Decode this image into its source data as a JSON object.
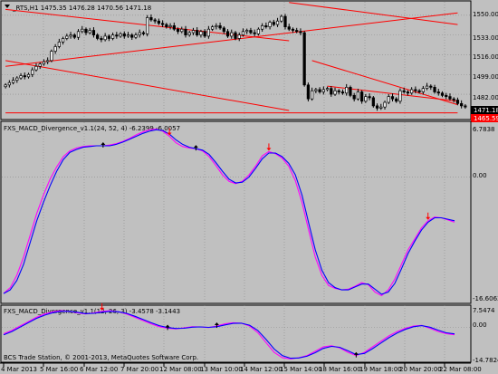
{
  "colors": {
    "background": "#c0c0c0",
    "grid": "#8c8c8c",
    "bull_candle": "#ffffff",
    "bear_candle": "#000000",
    "trendline": "#ff0000",
    "macd_line": "#0000ff",
    "signal_line": "#ff00ff",
    "price_tag_bg": "#000000",
    "price_tag_red": "#ff0000",
    "arrow_up": "#000000",
    "arrow_down": "#ff0000"
  },
  "main_panel": {
    "title": "_RTS,H1  1475.35 1476.28 1470.56 1471.18",
    "y_ticks": [
      "1550.00",
      "1533.00",
      "1516.00",
      "1499.00",
      "1482.00"
    ],
    "current_price": "1471.18",
    "red_price": "1465.59"
  },
  "indicator1": {
    "title": "FXS_MACD_Divergence_v1.1(24, 52, 4) -6.2399 -6.0057",
    "y_ticks": [
      "6.7838",
      "0.00",
      "-16.6063"
    ]
  },
  "indicator2": {
    "title": "FXS_MACD_Divergence_v1.1(12, 26, 3) -3.4578 -3.1443",
    "y_ticks": [
      "7.5474",
      "0.00",
      "-14.7824"
    ]
  },
  "copyright": "BCS Trade Station, © 2001-2013, MetaQuotes Software Corp.",
  "x_ticks": [
    "4 Mar 2013",
    "5 Mar 16:00",
    "6 Mar 12:00",
    "7 Mar 20:00",
    "12 Mar 08:00",
    "13 Mar 10:00",
    "14 Mar 12:00",
    "15 Mar 14:00",
    "18 Mar 16:00",
    "19 Mar 18:00",
    "20 Mar 20:00",
    "22 Mar 08:00"
  ],
  "chart_data": [
    {
      "type": "candlestick",
      "title": "_RTS,H1  1475.35 1476.28 1470.56 1471.18",
      "symbol": "_RTS,H1",
      "ohlc_last": {
        "open": 1475.35,
        "high": 1476.28,
        "low": 1470.56,
        "close": 1471.18
      },
      "ylim": [
        1461,
        1560
      ],
      "x_labels": [
        "4 Mar 2013",
        "5 Mar 16:00",
        "6 Mar 12:00",
        "7 Mar 20:00",
        "12 Mar 08:00",
        "13 Mar 10:00",
        "14 Mar 12:00",
        "15 Mar 14:00",
        "18 Mar 16:00",
        "19 Mar 18:00",
        "20 Mar 20:00",
        "22 Mar 08:00"
      ],
      "close_series": [
        1490,
        1492,
        1494,
        1496,
        1498,
        1497,
        1499,
        1503,
        1506,
        1508,
        1510,
        1511,
        1519,
        1523,
        1527,
        1530,
        1532,
        1533,
        1531,
        1536,
        1538,
        1535,
        1537,
        1533,
        1530,
        1529,
        1532,
        1530,
        1533,
        1532,
        1534,
        1532,
        1533,
        1531,
        1533,
        1535,
        1534,
        1548,
        1546,
        1545,
        1543,
        1542,
        1540,
        1541,
        1538,
        1536,
        1538,
        1533,
        1535,
        1537,
        1533,
        1536,
        1532,
        1538,
        1540,
        1541,
        1539,
        1536,
        1532,
        1535,
        1530,
        1533,
        1536,
        1537,
        1535,
        1534,
        1538,
        1541,
        1540,
        1544,
        1542,
        1545,
        1549,
        1540,
        1538,
        1537,
        1536,
        1535,
        1490,
        1478,
        1485,
        1486,
        1484,
        1486,
        1487,
        1482,
        1485,
        1484,
        1483,
        1488,
        1481,
        1478,
        1484,
        1476,
        1480,
        1479,
        1472,
        1470,
        1471,
        1475,
        1480,
        1478,
        1476,
        1485,
        1484,
        1483,
        1486,
        1485,
        1484,
        1487,
        1489,
        1488,
        1484,
        1483,
        1481,
        1480,
        1478,
        1477,
        1474,
        1472,
        1471
      ],
      "trendlines": [
        {
          "from": [
            0,
            1555
          ],
          "to": [
            74,
            1528
          ]
        },
        {
          "from": [
            0,
            1506
          ],
          "to": [
            118,
            1552
          ]
        },
        {
          "from": [
            0,
            1511
          ],
          "to": [
            74,
            1468
          ]
        },
        {
          "from": [
            74,
            1561
          ],
          "to": [
            118,
            1542
          ]
        },
        {
          "from": [
            80,
            1511
          ],
          "to": [
            118,
            1473
          ]
        },
        {
          "from": [
            84,
            1489
          ],
          "to": [
            118,
            1476
          ]
        },
        {
          "from": [
            0,
            1466
          ],
          "to": [
            118,
            1466
          ]
        }
      ]
    },
    {
      "type": "line",
      "title": "FXS_MACD_Divergence_v1.1(24, 52, 4) -6.2399 -6.0057",
      "ylim": [
        -16.6063,
        6.7838
      ],
      "series": [
        {
          "values": [
            -16.0,
            -15.2,
            -13.5,
            -11.0,
            -8.0,
            -5.0,
            -2.5,
            -0.3,
            1.4,
            2.8,
            3.6,
            4.0,
            4.2,
            4.3,
            4.3,
            4.3,
            4.4,
            4.6,
            4.9,
            5.3,
            5.8,
            6.2,
            6.5,
            6.6,
            6.3,
            5.6,
            4.7,
            4.2,
            4.0,
            3.9,
            3.6,
            2.8,
            1.6,
            0.3,
            -0.6,
            -0.9,
            -0.6,
            0.3,
            1.5,
            2.9,
            3.5,
            3.2,
            2.6,
            1.5,
            -0.5,
            -3.5,
            -7.3,
            -11.0,
            -13.5,
            -14.9,
            -15.3,
            -15.5,
            -15.4,
            -15.0,
            -14.5,
            -14.8,
            -15.8,
            -16.3,
            -15.5,
            -14.0,
            -12.0,
            -10.0,
            -8.5,
            -7.0,
            -6.0,
            -5.5,
            -5.6,
            -5.9,
            -6.2
          ]
        },
        {
          "values": [
            -16.0,
            -15.5,
            -14.2,
            -12.0,
            -9.0,
            -6.0,
            -3.5,
            -1.2,
            0.8,
            2.4,
            3.4,
            3.8,
            4.1,
            4.2,
            4.3,
            4.3,
            4.3,
            4.5,
            4.8,
            5.2,
            5.6,
            6.0,
            6.3,
            6.5,
            6.4,
            5.9,
            5.1,
            4.5,
            4.1,
            3.9,
            3.7,
            3.1,
            2.0,
            0.8,
            -0.3,
            -0.8,
            -0.7,
            0.0,
            1.2,
            2.5,
            3.3,
            3.3,
            2.8,
            1.9,
            0.3,
            -2.5,
            -6.3,
            -10.0,
            -12.8,
            -14.5,
            -15.2,
            -15.5,
            -15.5,
            -15.1,
            -14.7,
            -14.7,
            -15.4,
            -16.1,
            -15.8,
            -14.6,
            -12.6,
            -10.5,
            -8.8,
            -7.3,
            -6.2,
            -5.6,
            -5.6,
            -5.8,
            -6.0
          ]
        }
      ],
      "markers": [
        {
          "index": 15,
          "value": 4.3,
          "kind": "up"
        },
        {
          "index": 25,
          "value": 5.6,
          "kind": "down"
        },
        {
          "index": 29,
          "value": 3.9,
          "kind": "up"
        },
        {
          "index": 40,
          "value": 3.5,
          "kind": "down"
        },
        {
          "index": 64,
          "value": -6.0,
          "kind": "down"
        }
      ]
    },
    {
      "type": "line",
      "title": "FXS_MACD_Divergence_v1.1(12, 26, 3) -3.4578 -3.1443",
      "ylim": [
        -14.7824,
        7.5474
      ],
      "series": [
        {
          "values": [
            -3.0,
            -1.5,
            0.5,
            2.5,
            4.5,
            6.0,
            7.0,
            7.5,
            7.2,
            6.5,
            6.0,
            6.5,
            7.2,
            7.5,
            7.0,
            6.0,
            4.5,
            3.0,
            1.5,
            0.2,
            -0.5,
            -0.8,
            -0.3,
            0.2,
            0.1,
            -0.2,
            0.5,
            1.5,
            2.0,
            1.8,
            0.5,
            -2.5,
            -7.0,
            -11.5,
            -14.0,
            -14.5,
            -14.0,
            -13.0,
            -11.0,
            -9.0,
            -8.5,
            -9.5,
            -11.5,
            -13.0,
            -11.5,
            -9.0,
            -6.5,
            -4.0,
            -2.0,
            -0.5,
            0.5,
            0.8,
            -0.5,
            -2.0,
            -3.0,
            -3.5
          ]
        },
        {
          "values": [
            -3.5,
            -2.0,
            0.0,
            2.0,
            4.0,
            5.5,
            6.6,
            7.2,
            7.2,
            6.8,
            6.2,
            6.3,
            6.8,
            7.2,
            7.0,
            6.3,
            5.0,
            3.5,
            2.0,
            0.7,
            -0.2,
            -0.6,
            -0.5,
            0.0,
            0.1,
            -0.1,
            0.2,
            1.0,
            1.7,
            1.8,
            0.9,
            -1.5,
            -5.5,
            -10.0,
            -13.0,
            -14.2,
            -14.1,
            -13.3,
            -11.7,
            -9.7,
            -8.8,
            -9.2,
            -10.8,
            -12.5,
            -12.0,
            -9.8,
            -7.3,
            -4.8,
            -2.7,
            -1.0,
            0.2,
            0.7,
            0.0,
            -1.4,
            -2.6,
            -3.1
          ]
        }
      ],
      "markers": [
        {
          "index": 12,
          "value": 7.2,
          "kind": "down"
        },
        {
          "index": 20,
          "value": -0.5,
          "kind": "up"
        },
        {
          "index": 26,
          "value": 0.5,
          "kind": "up"
        },
        {
          "index": 43,
          "value": -13.0,
          "kind": "up"
        }
      ]
    }
  ]
}
